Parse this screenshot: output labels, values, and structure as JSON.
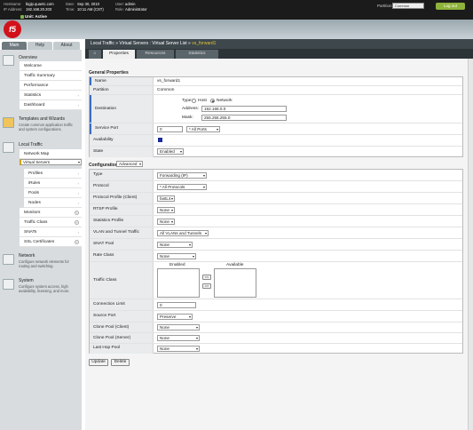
{
  "header": {
    "hostname_label": "Hostname:",
    "hostname": "bigip.quantc.com",
    "ip_label": "IP Address:",
    "ip": "192.168.20.203",
    "date_label": "Date:",
    "date": "Sep 30, 2010",
    "time_label": "Time:",
    "time": "10:11 AM (CST)",
    "user_label": "User:",
    "user": "admin",
    "role_label": "Role:",
    "role": "Administrator",
    "partition_label": "Partition:",
    "partition": "Common",
    "logout": "Log out",
    "unit_status": "Unit: Active",
    "logo": "f5"
  },
  "nav_tabs": [
    "Main",
    "Help",
    "About"
  ],
  "sidebar": {
    "overview": {
      "title": "Overview",
      "items": [
        "Welcome",
        "Traffic Summary",
        "Performance",
        "Statistics",
        "Dashboard"
      ]
    },
    "templates": {
      "title": "Templates and Wizards",
      "desc": "Create common application traffic and system configurations."
    },
    "local_traffic": {
      "title": "Local Traffic",
      "items": [
        "Network Map",
        "Virtual Servers",
        "Profiles",
        "iRules",
        "Pools",
        "Nodes",
        "Monitors",
        "Traffic Class",
        "SNATs",
        "SSL Certificates"
      ]
    },
    "network": {
      "title": "Network",
      "desc": "Configure network elements for routing and switching."
    },
    "system": {
      "title": "System",
      "desc": "Configure system access, high availability, licensing, and more."
    }
  },
  "breadcrumb": {
    "path": "Local Traffic » Virtual Servers : Virtual Server List » ",
    "current": "vs_forward1"
  },
  "content_tabs": {
    "home_icon": "⌂",
    "items": [
      "Properties",
      "Resources",
      "Statistics"
    ]
  },
  "general": {
    "title": "General Properties",
    "name_label": "Name",
    "name": "vs_forward1",
    "partition_label": "Partition",
    "partition": "Common",
    "destination_label": "Destination",
    "type_label": "Type:",
    "type_host": "Host",
    "type_network": "Network",
    "address_label": "Address:",
    "address": "192.168.0.0",
    "mask_label": "Mask:",
    "mask": "255.255.255.0",
    "service_port_label": "Service Port",
    "service_port": "0",
    "service_port_sel": "* All Ports",
    "availability_label": "Availability",
    "state_label": "State",
    "state": "Enabled"
  },
  "configuration": {
    "title": "Configuration:",
    "mode": "Advanced",
    "rows": [
      {
        "label": "Type",
        "value": "Forwarding (IP)"
      },
      {
        "label": "Protocol",
        "value": "* All Protocols"
      },
      {
        "label": "Protocol Profile (Client)",
        "value": "fastL4"
      },
      {
        "label": "RTSP Profile",
        "value": "None"
      },
      {
        "label": "Statistics Profile",
        "value": "None"
      },
      {
        "label": "VLAN and Tunnel Traffic",
        "value": "All VLANs and Tunnels"
      },
      {
        "label": "SNAT Pool",
        "value": "None"
      },
      {
        "label": "Rate Class",
        "value": "None"
      }
    ],
    "traffic_class_label": "Traffic Class",
    "enabled_label": "Enabled",
    "available_label": "Available",
    "move_left": "<<",
    "move_right": ">>",
    "connection_limit_label": "Connection Limit",
    "connection_limit": "0",
    "rows2": [
      {
        "label": "Source Port",
        "value": "Preserve"
      },
      {
        "label": "Clone Pool (Client)",
        "value": "None"
      },
      {
        "label": "Clone Pool (Server)",
        "value": "None"
      },
      {
        "label": "Last Hop Pool",
        "value": "None"
      }
    ]
  },
  "actions": {
    "update": "Update",
    "delete": "Delete"
  }
}
